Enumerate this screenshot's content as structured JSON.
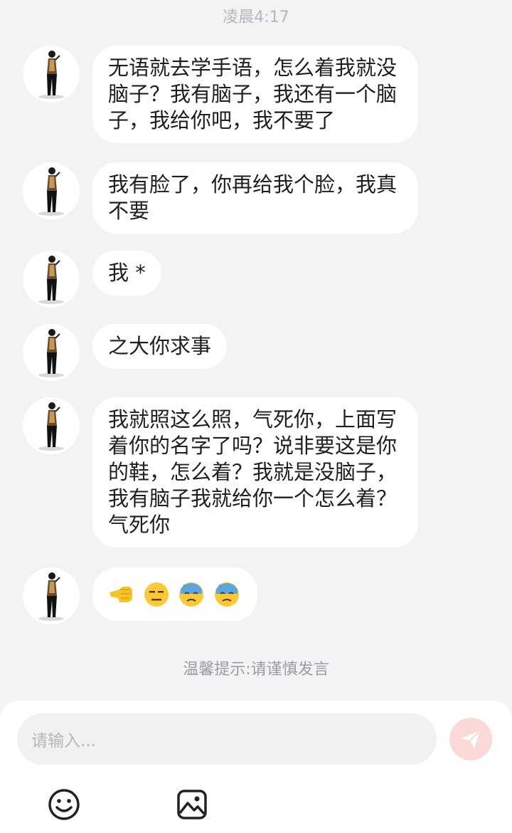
{
  "status": {
    "time": "凌晨4:17"
  },
  "messages": [
    {
      "text": "无语就去学手语，怎么着我就没脑子？我有脑子，我还有一个脑子，我给你吧，我不要了"
    },
    {
      "text": "我有脸了，你再给我个脸，我真不要"
    },
    {
      "text": "我 *"
    },
    {
      "text": "之大你求事"
    },
    {
      "text": "我就照这么照，气死你，上面写着你的名字了吗？说非要这是你的鞋，怎么着？我就是没脑子，我有脑子我就给你一个怎么着？气死你"
    },
    {
      "emojis": [
        "hand-point-left-icon",
        "expressionless-face-icon",
        "sweat-downcast-face-icon",
        "sweat-downcast-face-icon"
      ]
    }
  ],
  "tip": "温馨提示:请谨慎发言",
  "composer": {
    "placeholder": "请输入...",
    "send_icon": "send-icon",
    "emoji_icon": "emoji-icon",
    "image_icon": "image-icon",
    "send_color": "#fbd9d6"
  },
  "colors": {
    "background": "#f2f3f5",
    "bubble": "#ffffff",
    "text": "#1f1f1f"
  }
}
